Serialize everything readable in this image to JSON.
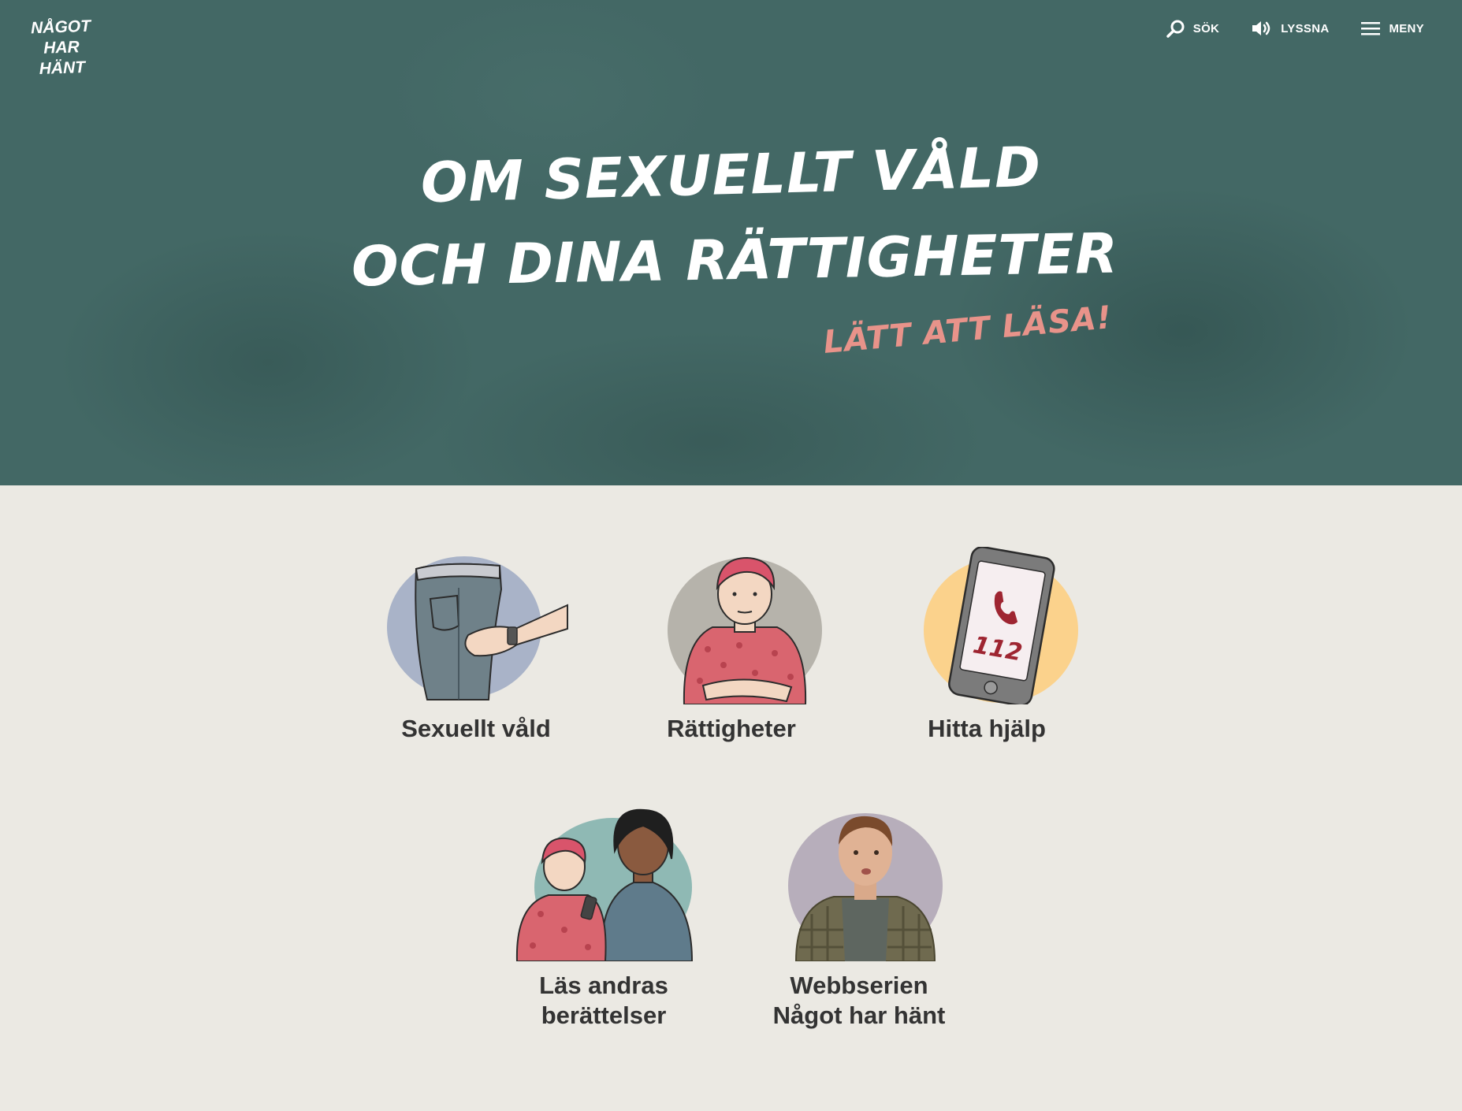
{
  "logo": {
    "line1": "NÅGOT",
    "line2": "HAR",
    "line3": "HÄNT"
  },
  "nav": {
    "search": {
      "label": "SÖK",
      "icon": "search-icon"
    },
    "listen": {
      "label": "LYSSNA",
      "icon": "speaker-icon"
    },
    "menu": {
      "label": "MENY",
      "icon": "hamburger-icon"
    }
  },
  "hero": {
    "title_line1": "OM SEXUELLT VÅLD",
    "title_line2": "OCH DINA RÄTTIGHETER",
    "tagline": "LÄTT ATT LÄSA!"
  },
  "cards": [
    {
      "label": "Sexuellt våld",
      "icon": "jeans-hand-illustration"
    },
    {
      "label": "Rättigheter",
      "icon": "woman-arms-crossed-illustration"
    },
    {
      "label": "Hitta hjälp",
      "icon": "phone-112-illustration",
      "phone_text": "112"
    },
    {
      "label_line1": "Läs andras",
      "label_line2": "berättelser",
      "icon": "two-women-illustration"
    },
    {
      "label_line1": "Webbserien",
      "label_line2": "Något har hänt",
      "icon": "web-series-actor-illustration"
    }
  ],
  "colors": {
    "hero_bg": "#436865",
    "page_bg": "#ebe9e3",
    "accent_pink": "#e8938a",
    "text_dark": "#333333"
  }
}
